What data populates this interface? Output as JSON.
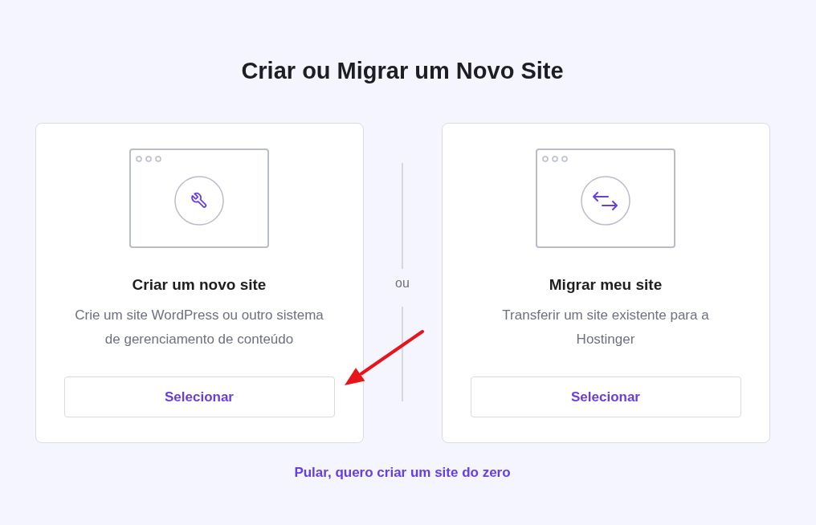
{
  "heading": "Criar ou Migrar um Novo Site",
  "options": [
    {
      "kind": "create",
      "title": "Criar um novo site",
      "description": "Crie um site WordPress ou outro sistema de gerenciamento de conteúdo",
      "button": "Selecionar"
    },
    {
      "kind": "migrate",
      "title": "Migrar meu site",
      "description": "Transferir um site existente para a Hostinger",
      "button": "Selecionar"
    }
  ],
  "separator": "ou",
  "skip_link": "Pular, quero criar um site do zero"
}
